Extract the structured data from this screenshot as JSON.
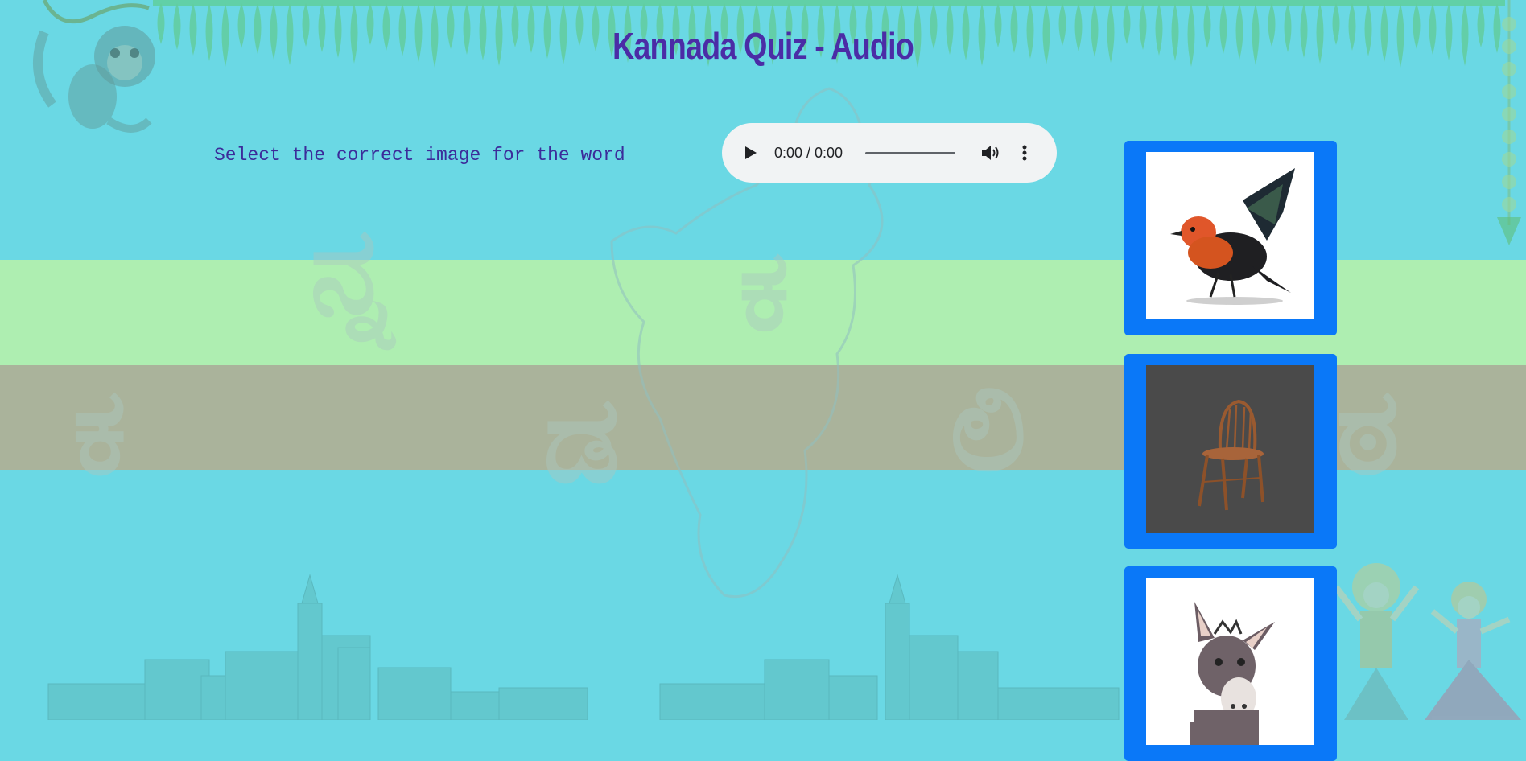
{
  "page": {
    "title": "Kannada Quiz - Audio",
    "prompt": "Select the correct image for the word"
  },
  "audio_player": {
    "time_display": "0:00 / 0:00",
    "progress": 0
  },
  "options": [
    {
      "subject": "bird",
      "icon": "bird-image"
    },
    {
      "subject": "chair",
      "icon": "chair-image"
    },
    {
      "subject": "donkey",
      "icon": "donkey-image"
    }
  ],
  "decor": {
    "kannada_glyphs": [
      "ನ್ನ",
      "ಕ",
      "ಕ",
      "ಡ",
      "ಲಿ",
      "ಠ"
    ]
  },
  "colors": {
    "background": "#6ad8e4",
    "title": "#4b2ca6",
    "prompt": "#3c2c9a",
    "option_frame": "#0a78f8",
    "band_green": "#aeeeb1",
    "band_gray": "#aab39b"
  }
}
